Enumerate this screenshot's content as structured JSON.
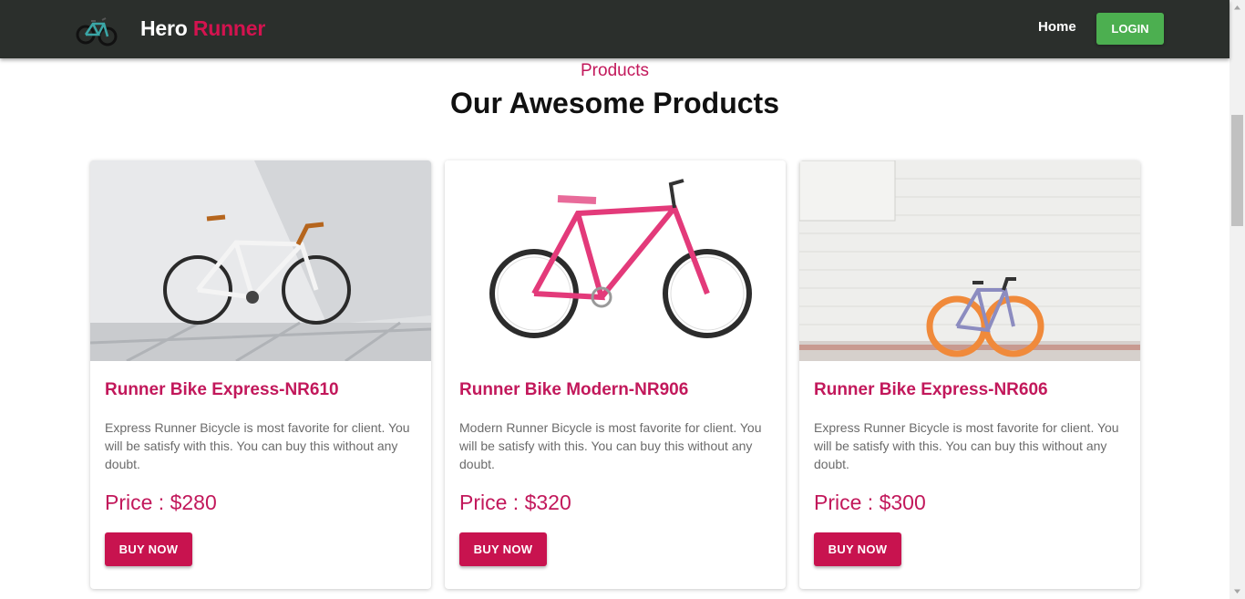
{
  "navbar": {
    "logo_icon": "bicycle-logo-icon",
    "brand_first": "Hero",
    "brand_second": "Runner",
    "home_label": "Home",
    "login_label": "LOGIN"
  },
  "section": {
    "eyebrow": "Products",
    "title": "Our Awesome Products"
  },
  "products": [
    {
      "image_icon": "silver-bike-photo",
      "title": "Runner Bike Express-NR610",
      "description": "Express Runner Bicycle is most favorite for client. You will be satisfy with this. You can buy this without any doubt.",
      "price": "Price : $280",
      "button_label": "BUY NOW"
    },
    {
      "image_icon": "pink-bike-photo",
      "title": "Runner Bike Modern-NR906",
      "description": "Modern Runner Bicycle is most favorite for client. You will be satisfy with this. You can buy this without any doubt.",
      "price": "Price : $320",
      "button_label": "BUY NOW"
    },
    {
      "image_icon": "orange-wheel-bike-photo",
      "title": "Runner Bike Express-NR606",
      "description": "Express Runner Bicycle is most favorite for client. You will be satisfy with this. You can buy this without any doubt.",
      "price": "Price : $300",
      "button_label": "BUY NOW"
    }
  ],
  "colors": {
    "navbar_bg": "#2b2f2c",
    "accent": "#c2185b",
    "login_green": "#4caf50"
  }
}
